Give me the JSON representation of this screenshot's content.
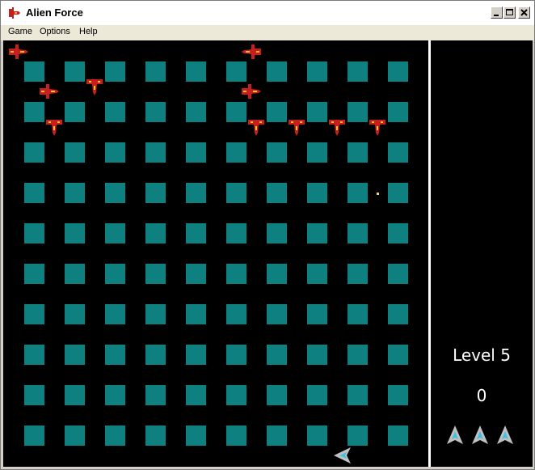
{
  "window": {
    "title": "Alien Force",
    "menu": [
      "Game",
      "Options",
      "Help"
    ]
  },
  "colors": {
    "block": "#0e8080",
    "background": "#000000",
    "alien_body": "#c81e1e",
    "alien_accent": "#f0c030",
    "player_body": "#c0c0c0",
    "player_accent": "#40c0e0",
    "bullet": "#ffd24a"
  },
  "game": {
    "level_label": "Level 5",
    "score": "0",
    "lives": 3,
    "grid": {
      "rows": 10,
      "cols": 10
    }
  }
}
